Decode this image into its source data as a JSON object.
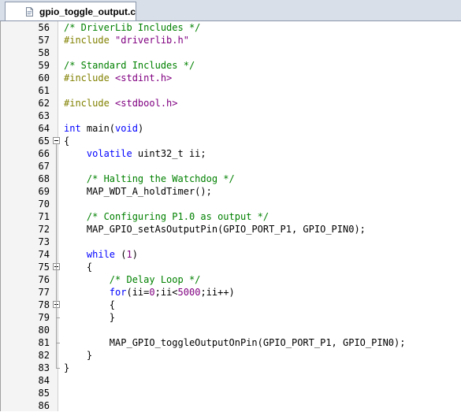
{
  "tab": {
    "label": "gpio_toggle_output.c",
    "icon": "c-file-icon"
  },
  "lines": [
    {
      "n": "56",
      "tokens": [
        {
          "t": "/* DriverLib Includes */",
          "c": "cm"
        }
      ]
    },
    {
      "n": "57",
      "tokens": [
        {
          "t": "#include ",
          "c": "pp"
        },
        {
          "t": "\"driverlib.h\"",
          "c": "st"
        }
      ]
    },
    {
      "n": "58",
      "tokens": []
    },
    {
      "n": "59",
      "tokens": [
        {
          "t": "/* Standard Includes */",
          "c": "cm"
        }
      ]
    },
    {
      "n": "60",
      "tokens": [
        {
          "t": "#include ",
          "c": "pp"
        },
        {
          "t": "<stdint.h>",
          "c": "st"
        }
      ]
    },
    {
      "n": "61",
      "tokens": []
    },
    {
      "n": "62",
      "tokens": [
        {
          "t": "#include ",
          "c": "pp"
        },
        {
          "t": "<stdbool.h>",
          "c": "st"
        }
      ]
    },
    {
      "n": "63",
      "tokens": []
    },
    {
      "n": "64",
      "tokens": [
        {
          "t": "int",
          "c": "kw"
        },
        {
          "t": " main(",
          "c": "id"
        },
        {
          "t": "void",
          "c": "kw"
        },
        {
          "t": ")",
          "c": "id"
        }
      ]
    },
    {
      "n": "65",
      "fold": "start",
      "tokens": [
        {
          "t": "{",
          "c": "id"
        }
      ]
    },
    {
      "n": "66",
      "tokens": [
        {
          "t": "    ",
          "c": "id"
        },
        {
          "t": "volatile",
          "c": "kw"
        },
        {
          "t": " uint32_t ii;",
          "c": "id"
        }
      ]
    },
    {
      "n": "67",
      "tokens": []
    },
    {
      "n": "68",
      "tokens": [
        {
          "t": "    ",
          "c": "id"
        },
        {
          "t": "/* Halting the Watchdog */",
          "c": "cm"
        }
      ]
    },
    {
      "n": "69",
      "tokens": [
        {
          "t": "    MAP_WDT_A_holdTimer();",
          "c": "id"
        }
      ]
    },
    {
      "n": "70",
      "tokens": []
    },
    {
      "n": "71",
      "tokens": [
        {
          "t": "    ",
          "c": "id"
        },
        {
          "t": "/* Configuring P1.0 as output */",
          "c": "cm"
        }
      ]
    },
    {
      "n": "72",
      "tokens": [
        {
          "t": "    MAP_GPIO_setAsOutputPin(GPIO_PORT_P1, GPIO_PIN0);",
          "c": "id"
        }
      ]
    },
    {
      "n": "73",
      "tokens": []
    },
    {
      "n": "74",
      "tokens": [
        {
          "t": "    ",
          "c": "id"
        },
        {
          "t": "while",
          "c": "kw"
        },
        {
          "t": " (",
          "c": "id"
        },
        {
          "t": "1",
          "c": "nm"
        },
        {
          "t": ")",
          "c": "id"
        }
      ]
    },
    {
      "n": "75",
      "fold": "start",
      "tokens": [
        {
          "t": "    {",
          "c": "id"
        }
      ]
    },
    {
      "n": "76",
      "tokens": [
        {
          "t": "        ",
          "c": "id"
        },
        {
          "t": "/* Delay Loop */",
          "c": "cm"
        }
      ]
    },
    {
      "n": "77",
      "tokens": [
        {
          "t": "        ",
          "c": "id"
        },
        {
          "t": "for",
          "c": "kw"
        },
        {
          "t": "(ii=",
          "c": "id"
        },
        {
          "t": "0",
          "c": "nm"
        },
        {
          "t": ";ii<",
          "c": "id"
        },
        {
          "t": "5000",
          "c": "nm"
        },
        {
          "t": ";ii++)",
          "c": "id"
        }
      ]
    },
    {
      "n": "78",
      "fold": "start",
      "tokens": [
        {
          "t": "        {",
          "c": "id"
        }
      ]
    },
    {
      "n": "79",
      "tokens": [
        {
          "t": "        }",
          "c": "id"
        }
      ]
    },
    {
      "n": "80",
      "tokens": []
    },
    {
      "n": "81",
      "tokens": [
        {
          "t": "        MAP_GPIO_toggleOutputOnPin(GPIO_PORT_P1, GPIO_PIN0);",
          "c": "id"
        }
      ]
    },
    {
      "n": "82",
      "tokens": [
        {
          "t": "    }",
          "c": "id"
        }
      ]
    },
    {
      "n": "83",
      "tokens": [
        {
          "t": "}",
          "c": "id"
        }
      ]
    },
    {
      "n": "84",
      "tokens": []
    },
    {
      "n": "85",
      "tokens": []
    },
    {
      "n": "86",
      "tokens": []
    }
  ]
}
